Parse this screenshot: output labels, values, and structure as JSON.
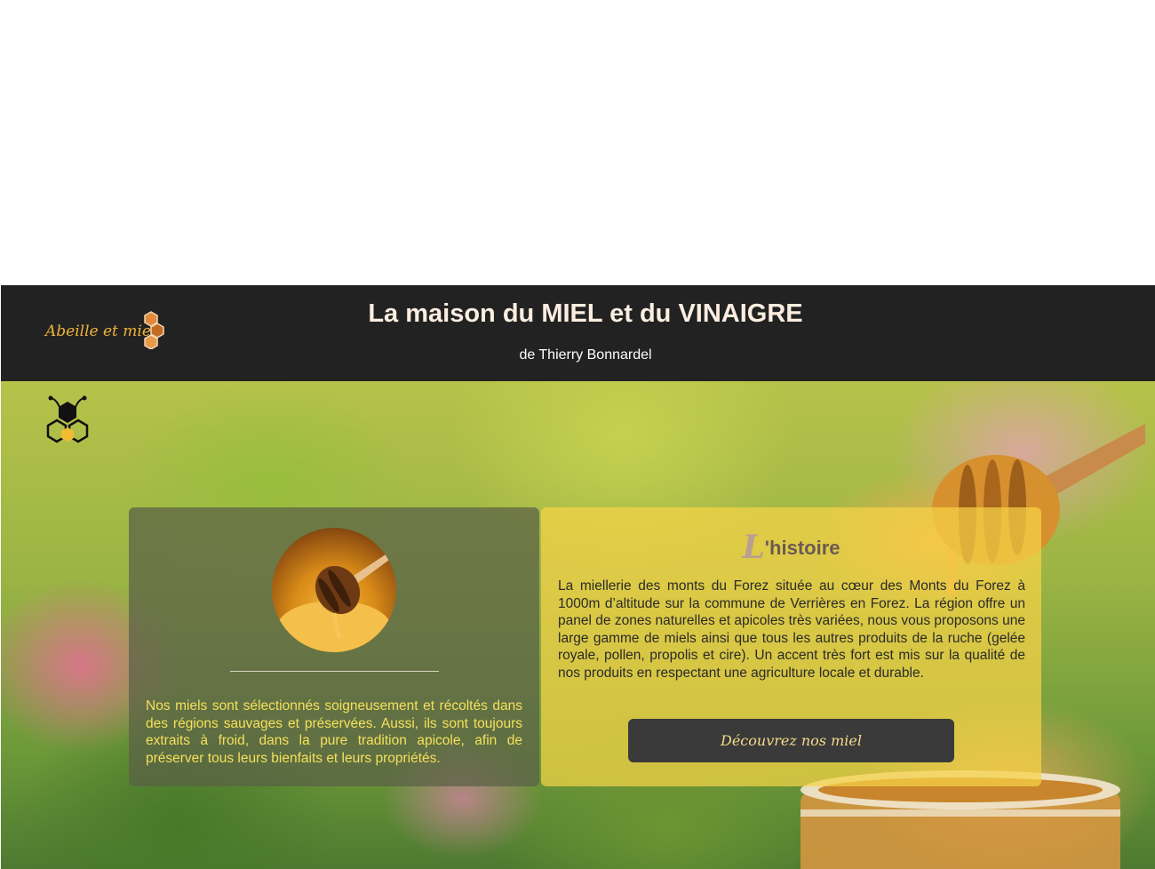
{
  "header": {
    "logo_text": "Abeille et miel",
    "title": "La maison du MIEL et du VINAIGRE",
    "subtitle": "de Thierry Bonnardel"
  },
  "hero": {
    "bee_icon": "bee-honeycomb-icon"
  },
  "left_panel": {
    "image": "honey-dipper-in-jar-photo",
    "text": "Nos miels sont sélectionnés soigneusement et récoltés dans des régions sauvages et préservées. Aussi, ils sont toujours extraits à froid, dans la pure tradition apicole, afin de préserver tous leurs bienfaits et leurs propriétés."
  },
  "right_panel": {
    "heading_first_letter": "L",
    "heading_rest": "'histoire",
    "text": "La miellerie des monts du Forez située au cœur des Monts du Forez à 1000m d’altitude sur la commune de Verrières en Forez. La région offre un panel de zones naturelles et apicoles très variées, nous vous proposons une large gamme de miels ainsi que tous les autres produits de la ruche (gelée royale, pollen, propolis et cire). Un accent très fort est mis sur la qualité de nos produits en respectant une agriculture locale et durable.",
    "button_label": "Découvrez nos miel"
  },
  "colors": {
    "header_bg": "#222222",
    "accent_gold": "#f0b43a",
    "left_text": "#f5e05a",
    "button_bg": "#3a3a3a"
  }
}
